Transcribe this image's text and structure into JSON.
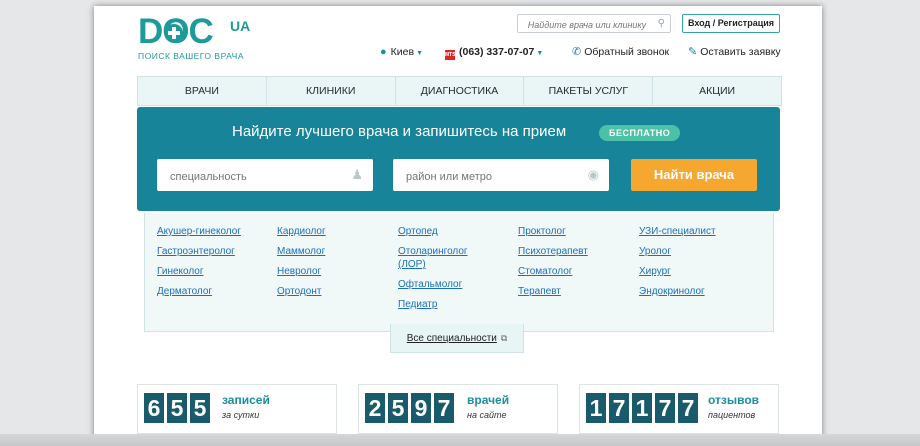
{
  "logo": {
    "word": "DOC",
    "suffix": "UA",
    "tagline": "ПОИСК ВАШЕГО ВРАЧА"
  },
  "header": {
    "search_placeholder": "Найдите врача или клинику",
    "login_label": "Вход / Регистрация",
    "city": "Киев",
    "phone": "(063) 337-07-07",
    "callback": "Обратный звонок",
    "request": "Оставить заявку"
  },
  "nav": {
    "items": [
      "ВРАЧИ",
      "КЛИНИКИ",
      "ДИАГНОСТИКА",
      "ПАКЕТЫ УСЛУГ",
      "АКЦИИ"
    ]
  },
  "hero": {
    "title": "Найдите лучшего врача и запишитесь на прием",
    "badge": "БЕСПЛАТНО",
    "specialty_placeholder": "специальность",
    "district_placeholder": "район или метро",
    "find_button": "Найти врача"
  },
  "specialties": {
    "columns": [
      [
        "Акушер-гинеколог",
        "Гастроэнтеролог",
        "Гинеколог",
        "Дерматолог"
      ],
      [
        "Кардиолог",
        "Маммолог",
        "Невролог",
        "Ортодонт"
      ],
      [
        "Ортопед",
        "Отоларинголог (ЛОР)",
        "Офтальмолог",
        "Педиатр"
      ],
      [
        "Проктолог",
        "Психотерапевт",
        "Стоматолог",
        "Терапевт"
      ],
      [
        "УЗИ-специалист",
        "Уролог",
        "Хирург",
        "Эндокринолог"
      ]
    ],
    "all_label": "Все специальности"
  },
  "counters": [
    {
      "digits": [
        "6",
        "5",
        "5"
      ],
      "label": "записей",
      "sub": "за сутки"
    },
    {
      "digits": [
        "2",
        "5",
        "9",
        "7"
      ],
      "label": "врачей",
      "sub": "на сайте"
    },
    {
      "digits": [
        "1",
        "7",
        "1",
        "7",
        "7"
      ],
      "label": "отзывов",
      "sub": "пациентов"
    }
  ],
  "colors": {
    "accent": "#1f9a9c",
    "hero": "#18849a",
    "button": "#f5a730",
    "badge": "#4bc2a5",
    "link": "#1d6fb8"
  }
}
